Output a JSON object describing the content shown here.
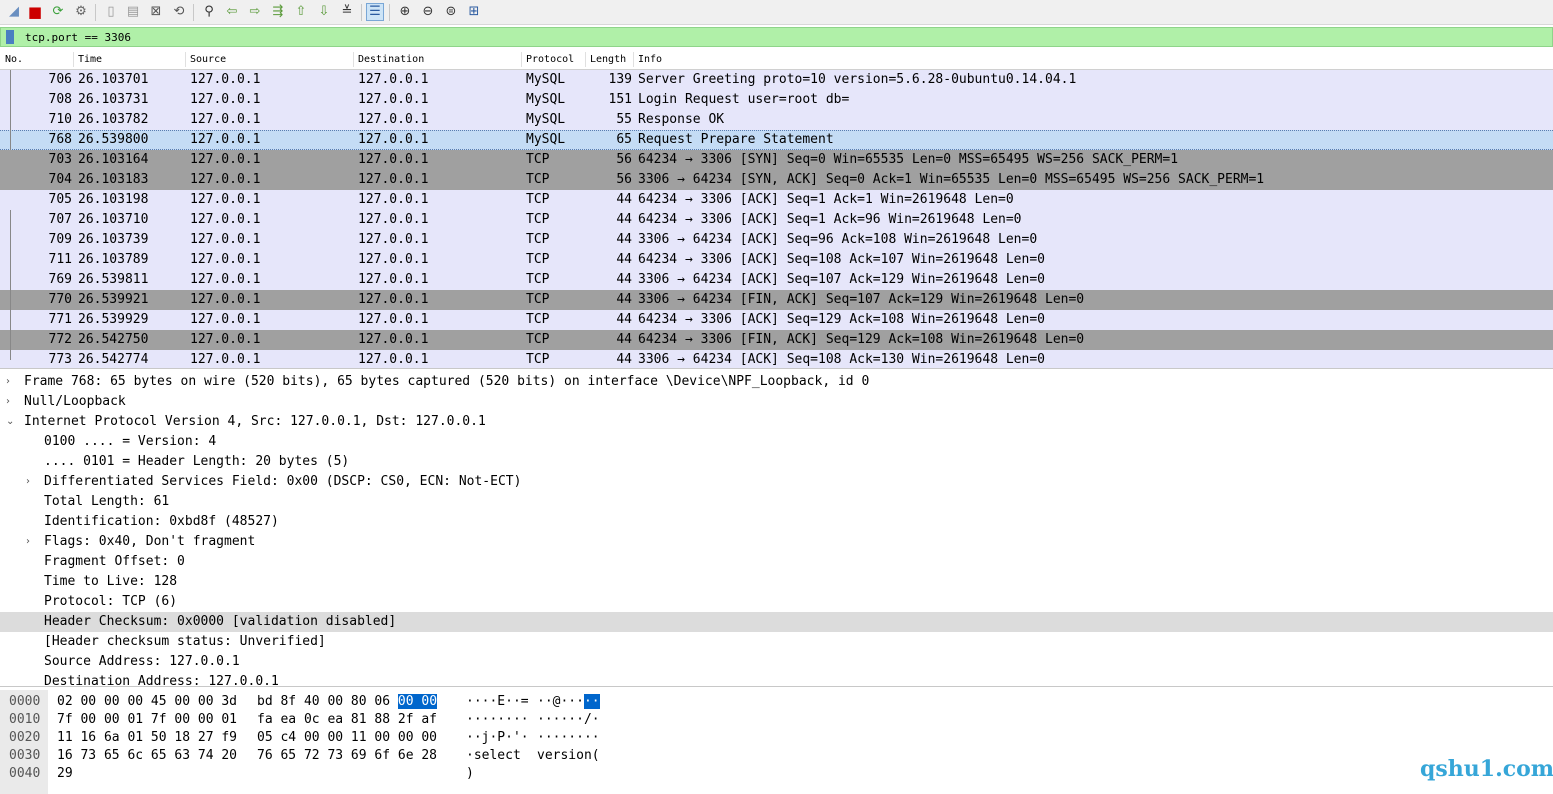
{
  "filter": {
    "text": "tcp.port == 3306"
  },
  "columns": [
    "No.",
    "Time",
    "Source",
    "Destination",
    "Protocol",
    "Length",
    "Info"
  ],
  "packets": [
    {
      "no": "706",
      "time": "26.103701",
      "src": "127.0.0.1",
      "dst": "127.0.0.1",
      "proto": "MySQL",
      "len": "139",
      "info": "Server Greeting proto=10 version=5.6.28-0ubuntu0.14.04.1",
      "style": "normal"
    },
    {
      "no": "708",
      "time": "26.103731",
      "src": "127.0.0.1",
      "dst": "127.0.0.1",
      "proto": "MySQL",
      "len": "151",
      "info": "Login Request user=root db=",
      "style": "normal"
    },
    {
      "no": "710",
      "time": "26.103782",
      "src": "127.0.0.1",
      "dst": "127.0.0.1",
      "proto": "MySQL",
      "len": "55",
      "info": "Response OK",
      "style": "normal"
    },
    {
      "no": "768",
      "time": "26.539800",
      "src": "127.0.0.1",
      "dst": "127.0.0.1",
      "proto": "MySQL",
      "len": "65",
      "info": "Request Prepare Statement",
      "style": "selected"
    },
    {
      "no": "703",
      "time": "26.103164",
      "src": "127.0.0.1",
      "dst": "127.0.0.1",
      "proto": "TCP",
      "len": "56",
      "info": "64234 → 3306 [SYN] Seq=0 Win=65535 Len=0 MSS=65495 WS=256 SACK_PERM=1",
      "style": "dark"
    },
    {
      "no": "704",
      "time": "26.103183",
      "src": "127.0.0.1",
      "dst": "127.0.0.1",
      "proto": "TCP",
      "len": "56",
      "info": "3306 → 64234 [SYN, ACK] Seq=0 Ack=1 Win=65535 Len=0 MSS=65495 WS=256 SACK_PERM=1",
      "style": "dark"
    },
    {
      "no": "705",
      "time": "26.103198",
      "src": "127.0.0.1",
      "dst": "127.0.0.1",
      "proto": "TCP",
      "len": "44",
      "info": "64234 → 3306 [ACK] Seq=1 Ack=1 Win=2619648 Len=0",
      "style": "normal"
    },
    {
      "no": "707",
      "time": "26.103710",
      "src": "127.0.0.1",
      "dst": "127.0.0.1",
      "proto": "TCP",
      "len": "44",
      "info": "64234 → 3306 [ACK] Seq=1 Ack=96 Win=2619648 Len=0",
      "style": "normal"
    },
    {
      "no": "709",
      "time": "26.103739",
      "src": "127.0.0.1",
      "dst": "127.0.0.1",
      "proto": "TCP",
      "len": "44",
      "info": "3306 → 64234 [ACK] Seq=96 Ack=108 Win=2619648 Len=0",
      "style": "normal"
    },
    {
      "no": "711",
      "time": "26.103789",
      "src": "127.0.0.1",
      "dst": "127.0.0.1",
      "proto": "TCP",
      "len": "44",
      "info": "64234 → 3306 [ACK] Seq=108 Ack=107 Win=2619648 Len=0",
      "style": "normal"
    },
    {
      "no": "769",
      "time": "26.539811",
      "src": "127.0.0.1",
      "dst": "127.0.0.1",
      "proto": "TCP",
      "len": "44",
      "info": "3306 → 64234 [ACK] Seq=107 Ack=129 Win=2619648 Len=0",
      "style": "normal"
    },
    {
      "no": "770",
      "time": "26.539921",
      "src": "127.0.0.1",
      "dst": "127.0.0.1",
      "proto": "TCP",
      "len": "44",
      "info": "3306 → 64234 [FIN, ACK] Seq=107 Ack=129 Win=2619648 Len=0",
      "style": "dark"
    },
    {
      "no": "771",
      "time": "26.539929",
      "src": "127.0.0.1",
      "dst": "127.0.0.1",
      "proto": "TCP",
      "len": "44",
      "info": "64234 → 3306 [ACK] Seq=129 Ack=108 Win=2619648 Len=0",
      "style": "normal"
    },
    {
      "no": "772",
      "time": "26.542750",
      "src": "127.0.0.1",
      "dst": "127.0.0.1",
      "proto": "TCP",
      "len": "44",
      "info": "64234 → 3306 [FIN, ACK] Seq=129 Ack=108 Win=2619648 Len=0",
      "style": "dark"
    },
    {
      "no": "773",
      "time": "26.542774",
      "src": "127.0.0.1",
      "dst": "127.0.0.1",
      "proto": "TCP",
      "len": "44",
      "info": "3306 → 64234 [ACK] Seq=108 Ack=130 Win=2619648 Len=0",
      "style": "normal"
    }
  ],
  "details": [
    {
      "text": "Frame 768: 65 bytes on wire (520 bits), 65 bytes captured (520 bits) on interface \\Device\\NPF_Loopback, id 0",
      "level": 0,
      "arrow": "collapsed",
      "highlight": false
    },
    {
      "text": "Null/Loopback",
      "level": 0,
      "arrow": "collapsed",
      "highlight": false
    },
    {
      "text": "Internet Protocol Version 4, Src: 127.0.0.1, Dst: 127.0.0.1",
      "level": 0,
      "arrow": "expanded",
      "highlight": false
    },
    {
      "text": "0100 .... = Version: 4",
      "level": 1,
      "arrow": "none",
      "highlight": false
    },
    {
      "text": ".... 0101 = Header Length: 20 bytes (5)",
      "level": 1,
      "arrow": "none",
      "highlight": false
    },
    {
      "text": "Differentiated Services Field: 0x00 (DSCP: CS0, ECN: Not-ECT)",
      "level": 1,
      "arrow": "collapsed",
      "highlight": false
    },
    {
      "text": "Total Length: 61",
      "level": 1,
      "arrow": "none",
      "highlight": false
    },
    {
      "text": "Identification: 0xbd8f (48527)",
      "level": 1,
      "arrow": "none",
      "highlight": false
    },
    {
      "text": "Flags: 0x40, Don't fragment",
      "level": 1,
      "arrow": "collapsed",
      "highlight": false
    },
    {
      "text": "Fragment Offset: 0",
      "level": 1,
      "arrow": "none",
      "highlight": false
    },
    {
      "text": "Time to Live: 128",
      "level": 1,
      "arrow": "none",
      "highlight": false
    },
    {
      "text": "Protocol: TCP (6)",
      "level": 1,
      "arrow": "none",
      "highlight": false
    },
    {
      "text": "Header Checksum: 0x0000 [validation disabled]",
      "level": 1,
      "arrow": "none",
      "highlight": true
    },
    {
      "text": "[Header checksum status: Unverified]",
      "level": 1,
      "arrow": "none",
      "highlight": false
    },
    {
      "text": "Source Address: 127.0.0.1",
      "level": 1,
      "arrow": "none",
      "highlight": false
    },
    {
      "text": "Destination Address: 127.0.0.1",
      "level": 1,
      "arrow": "none",
      "highlight": false
    }
  ],
  "arrows": {
    "collapsed": "›",
    "expanded": "⌄"
  },
  "bytes": [
    {
      "off": "0000",
      "hex1": "02 00 00 00 45 00 00 3d",
      "hex2a": "bd 8f 40 00 80 06",
      "hex2sel": "00 00",
      "asc1": "····E··=",
      "asc2a": "··@···",
      "asc2sel": "··"
    },
    {
      "off": "0010",
      "hex1": "7f 00 00 01 7f 00 00 01",
      "hex2a": "fa ea 0c ea 81 88 2f af",
      "hex2sel": "",
      "asc1": "········",
      "asc2a": "······/·",
      "asc2sel": ""
    },
    {
      "off": "0020",
      "hex1": "11 16 6a 01 50 18 27 f9",
      "hex2a": "05 c4 00 00 11 00 00 00",
      "hex2sel": "",
      "asc1": "··j·P·'·",
      "asc2a": "········",
      "asc2sel": ""
    },
    {
      "off": "0030",
      "hex1": "16 73 65 6c 65 63 74 20",
      "hex2a": "76 65 72 73 69 6f 6e 28",
      "hex2sel": "",
      "asc1": "·select ",
      "asc2a": "version(",
      "asc2sel": ""
    },
    {
      "off": "0040",
      "hex1": "29",
      "hex2a": "",
      "hex2sel": "",
      "asc1": ")",
      "asc2a": "",
      "asc2sel": ""
    }
  ],
  "watermark": "qshu1.com",
  "toolbar": {
    "icons": [
      "shark-fin-icon",
      "stop-icon",
      "restart-icon",
      "options-icon",
      "open-icon",
      "save-icon",
      "close-file-icon",
      "reload-icon",
      "find-icon",
      "back-icon",
      "forward-icon",
      "goto-icon",
      "first-icon",
      "last-icon",
      "autoscroll-icon",
      "colorize-icon",
      "zoom-in-icon",
      "zoom-out-icon",
      "zoom-normal-icon",
      "resize-columns-icon"
    ],
    "colors": {
      "stop": "#cc0000",
      "restart": "#3aa03a",
      "fin": "#6a8fc0"
    }
  }
}
